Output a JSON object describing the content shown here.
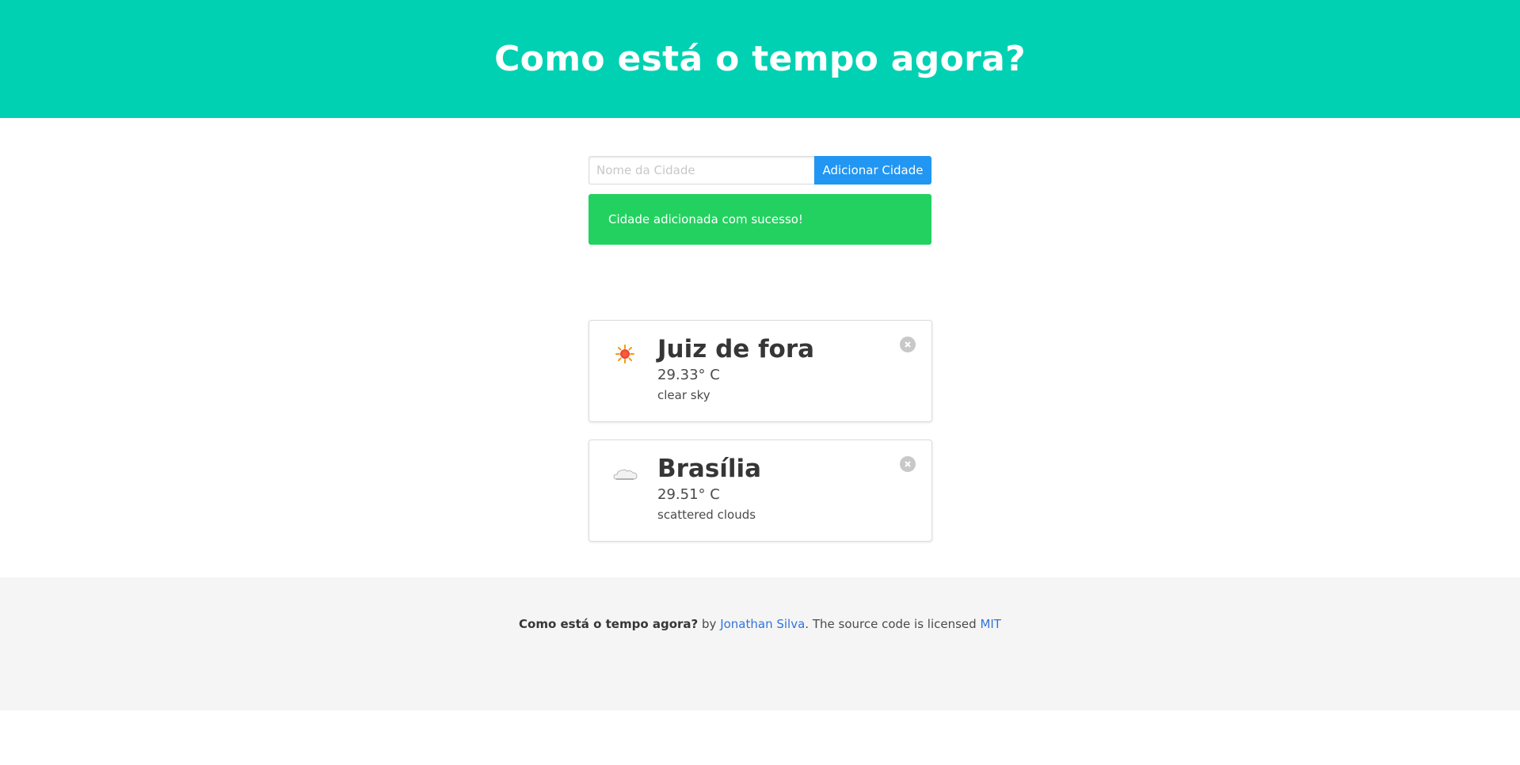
{
  "hero": {
    "title": "Como está o tempo agora?",
    "background": "#00d1b2"
  },
  "form": {
    "city_placeholder": "Nome da Cidade",
    "city_value": "",
    "add_button_label": "Adicionar Cidade",
    "button_color": "#2196f3"
  },
  "notification": {
    "message": "Cidade adicionada com sucesso!",
    "color": "#23d160"
  },
  "cities": [
    {
      "name": "Juiz de fora",
      "temperature": "29.33° C",
      "description": "clear sky",
      "icon": "sun-icon"
    },
    {
      "name": "Brasília",
      "temperature": "29.51° C",
      "description": "scattered clouds",
      "icon": "cloud-icon"
    }
  ],
  "footer": {
    "app_name": "Como está o tempo agora?",
    "by_text": " by ",
    "author_link": "Jonathan Silva",
    "license_text": ". The source code is licensed ",
    "license_link": "MIT",
    "link_color": "#3273dc",
    "background": "#f5f5f5"
  }
}
